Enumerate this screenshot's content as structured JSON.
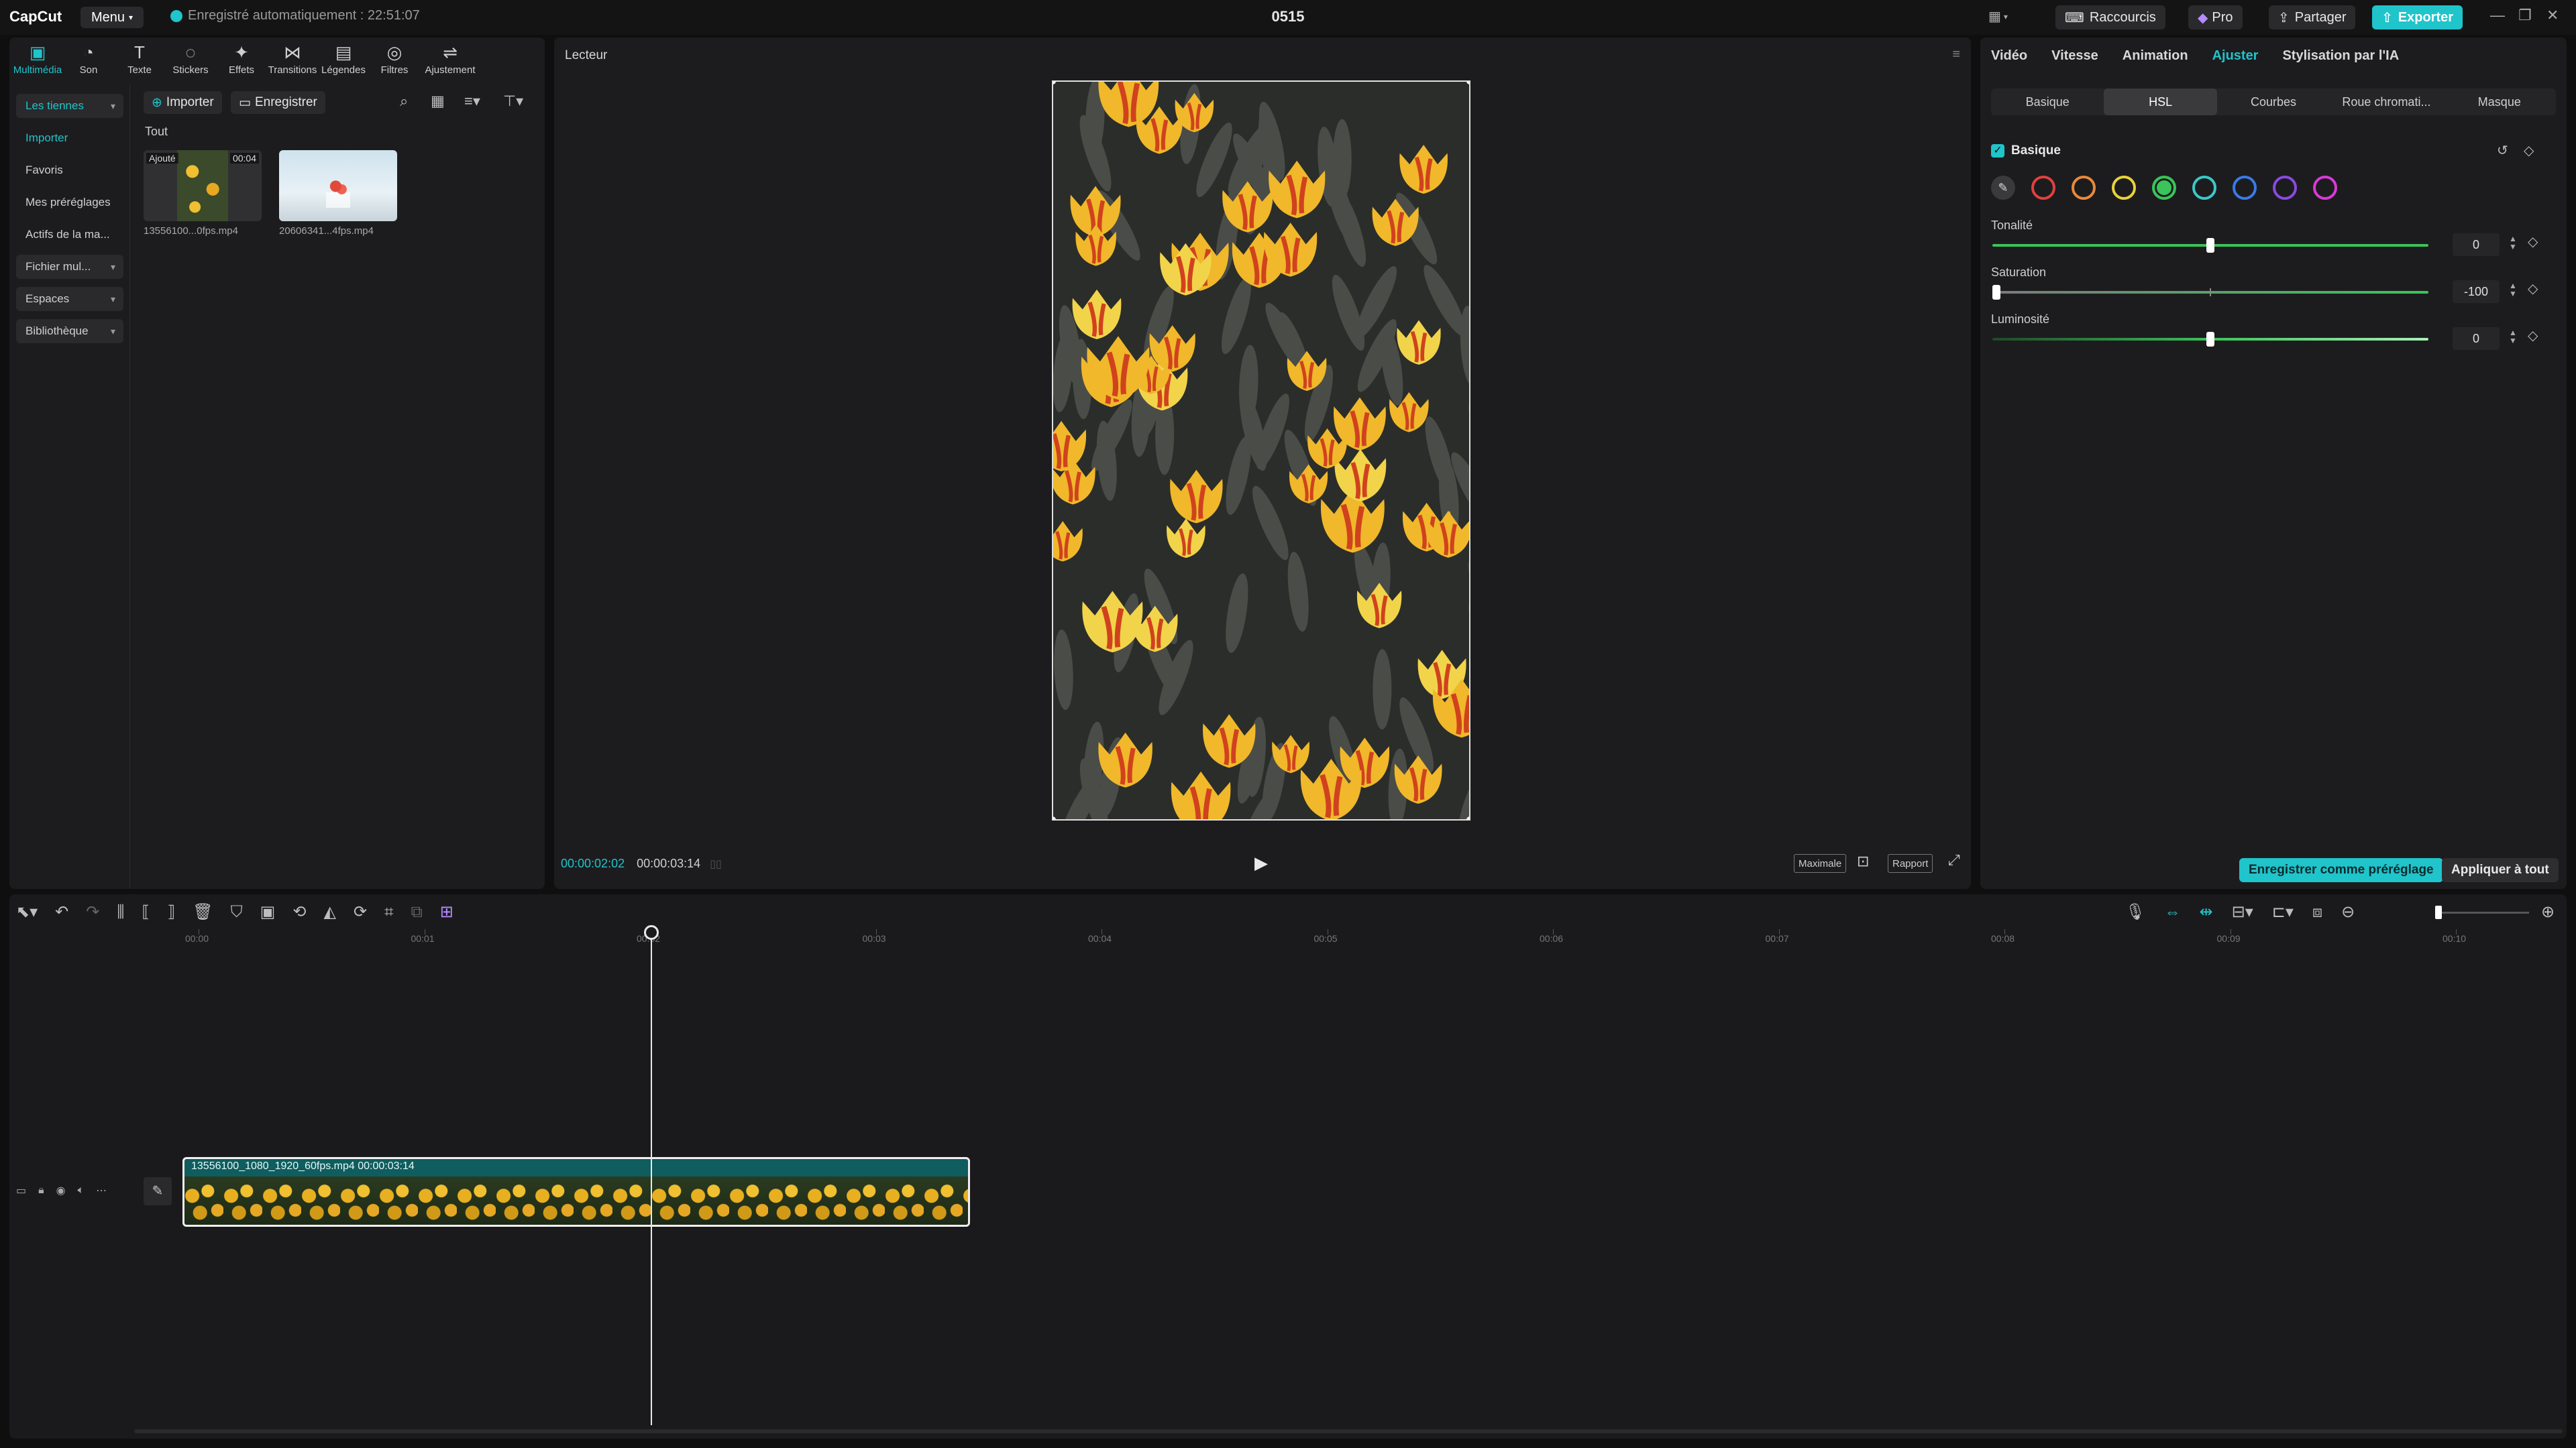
{
  "app": {
    "logo": "CapCut",
    "menu_label": "Menu",
    "autosave": "Enregistré automatiquement : 22:51:07",
    "project_title": "0515",
    "shortcuts_label": "Raccourcis",
    "pro_label": "Pro",
    "share_label": "Partager",
    "export_label": "Exporter"
  },
  "media": {
    "tools": [
      {
        "label": "Multimédia",
        "icon": "▣"
      },
      {
        "label": "Son",
        "icon": "◔"
      },
      {
        "label": "Texte",
        "icon": "T"
      },
      {
        "label": "Stickers",
        "icon": "◌"
      },
      {
        "label": "Effets",
        "icon": "✦"
      },
      {
        "label": "Transitions",
        "icon": "⋈"
      },
      {
        "label": "Légendes",
        "icon": "▤"
      },
      {
        "label": "Filtres",
        "icon": "◎"
      },
      {
        "label": "Ajustement",
        "icon": "⇌"
      }
    ],
    "sidebar": [
      "Les tiennes",
      "Importer",
      "Favoris",
      "Mes préréglages",
      "Actifs de la ma...",
      "Fichier mul...",
      "Espaces",
      "Bibliothèque"
    ],
    "import_label": "Importer",
    "record_label": "Enregistrer",
    "filter_all": "Tout",
    "items": [
      {
        "name": "13556100...0fps.mp4",
        "badge": "Ajouté",
        "duration": "00:04"
      },
      {
        "name": "20606341...4fps.mp4"
      }
    ]
  },
  "player": {
    "title": "Lecteur",
    "current_time": "00:00:02:02",
    "total_time": "00:00:03:14",
    "quality_label": "Maximale",
    "ratio_label": "Rapport"
  },
  "props": {
    "tabs": [
      "Vidéo",
      "Vitesse",
      "Animation",
      "Ajuster",
      "Stylisation par l'IA"
    ],
    "active_tab": "Ajuster",
    "subtabs": [
      "Basique",
      "HSL",
      "Courbes",
      "Roue chromati...",
      "Masque"
    ],
    "active_subtab": "HSL",
    "section_title": "Basique",
    "swatches": [
      "#e04040",
      "#e8893a",
      "#e8d23a",
      "#3ac45a",
      "#3ac8c8",
      "#3a7ae8",
      "#8a4ae0",
      "#d83ad8"
    ],
    "sliders": [
      {
        "label": "Tonalité",
        "value": "0",
        "fraction": 0.5
      },
      {
        "label": "Saturation",
        "value": "-100",
        "fraction": 0.0
      },
      {
        "label": "Luminosité",
        "value": "0",
        "fraction": 0.5
      }
    ],
    "save_preset_label": "Enregistrer comme préréglage",
    "apply_all_label": "Appliquer à tout"
  },
  "timeline": {
    "ruler": [
      "00:00",
      "00:01",
      "00:02",
      "00:03",
      "00:04",
      "00:05",
      "00:06",
      "00:07",
      "00:08",
      "00:09",
      "00:10"
    ],
    "clip_label": "13556100_1080_1920_60fps.mp4   00:00:03:14"
  }
}
